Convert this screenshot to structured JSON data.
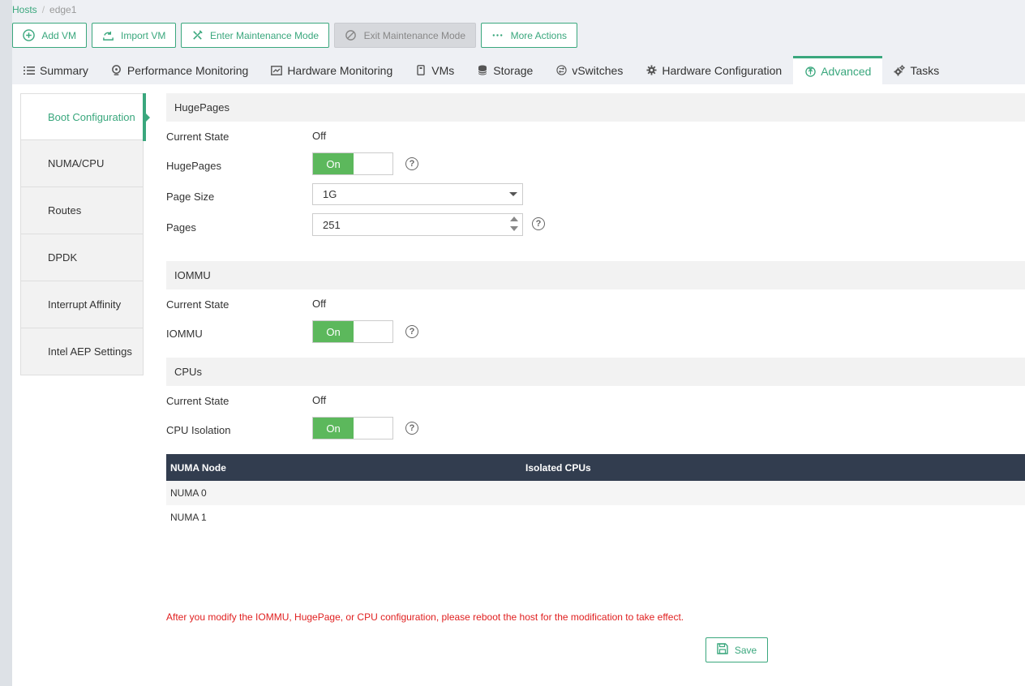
{
  "breadcrumb": {
    "root": "Hosts",
    "sep": "/",
    "current": "edge1"
  },
  "toolbar": {
    "add_vm": "Add VM",
    "import_vm": "Import VM",
    "enter_maintenance": "Enter Maintenance Mode",
    "exit_maintenance": "Exit Maintenance Mode",
    "more_actions": "More Actions"
  },
  "tabs": [
    "Summary",
    "Performance Monitoring",
    "Hardware Monitoring",
    "VMs",
    "Storage",
    "vSwitches",
    "Hardware Configuration",
    "Advanced",
    "Tasks"
  ],
  "active_tab": "Advanced",
  "sidebar": [
    "Boot Configuration",
    "NUMA/CPU",
    "Routes",
    "DPDK",
    "Interrupt Affinity",
    "Intel AEP Settings"
  ],
  "hugepages": {
    "section": "HugePages",
    "current_state_label": "Current State",
    "current_state": "Off",
    "toggle_label": "HugePages",
    "toggle_value": "On",
    "page_size_label": "Page Size",
    "page_size": "1G",
    "pages_label": "Pages",
    "pages": "251"
  },
  "iommu": {
    "section": "IOMMU",
    "current_state_label": "Current State",
    "current_state": "Off",
    "toggle_label": "IOMMU",
    "toggle_value": "On"
  },
  "cpus": {
    "section": "CPUs",
    "current_state_label": "Current State",
    "current_state": "Off",
    "toggle_label": "CPU Isolation",
    "toggle_value": "On"
  },
  "table": {
    "headers": [
      "NUMA Node",
      "Isolated CPUs"
    ],
    "rows": [
      [
        "NUMA 0",
        ""
      ],
      [
        "NUMA 1",
        ""
      ]
    ]
  },
  "warning": "After you modify the IOMMU, HugePage, or CPU configuration, please reboot the host for the modification to take effect.",
  "save_label": "Save",
  "help_glyph": "?",
  "colors": {
    "accent": "#3aa77d",
    "toggle_on": "#5cb85c",
    "table_header": "#323d4f",
    "warning": "#e02020"
  }
}
